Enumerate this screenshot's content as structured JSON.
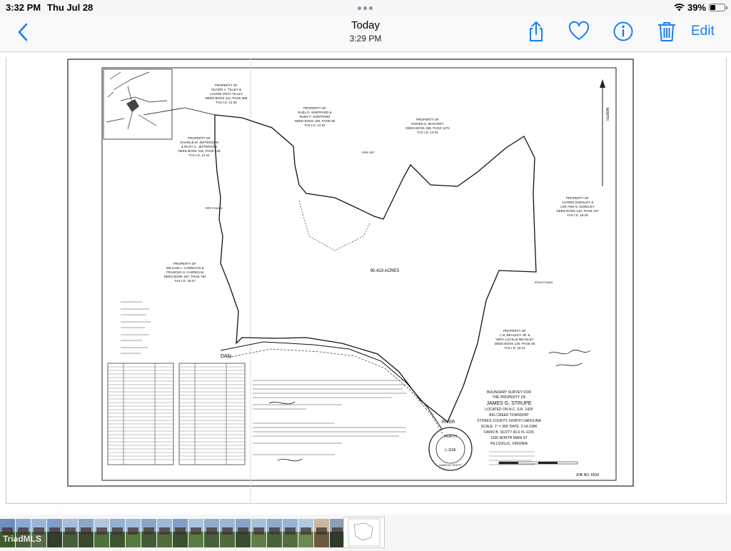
{
  "status": {
    "time": "3:32 PM",
    "date": "Thu Jul 28",
    "battery": "39%",
    "battery_level": 0.39
  },
  "nav": {
    "title": "Today",
    "subtitle": "3:29 PM",
    "edit_label": "Edit"
  },
  "colors": {
    "accent": "#157efb"
  },
  "icons": [
    "back-chevron-icon",
    "share-icon",
    "heart-icon",
    "info-icon",
    "trash-icon",
    "wifi-icon",
    "battery-icon"
  ],
  "plat": {
    "acres": "90.413 ACRES",
    "job_no": "JOB NO. 6539",
    "big_creek": "BIG CREEK TOWNSHIP",
    "stokes": "STOKES COUNTY, NORTH CAROLINA",
    "scale": "SCALE: 1\" = 300'  DATE: 2-14-1996",
    "surveyor": "DAVID B. SCOTT RLS #L-1156",
    "address": "1626 NORTH MAIN ST",
    "city": "HILLSVILLE, VIRGINIA",
    "boundary": "BOUNDARY SURVEY FOR",
    "property_of": "THE PROPERTY OF",
    "owner": "JAMES G. STRUPE",
    "located": "LOCATED ON N.C. S.R. 1425",
    "labels": {
      "tilley": [
        "PROPERTY OF",
        "OLIVER A. TILLEY &",
        "LOUISE GRAY TILLEY",
        "DEED BOOK 113, PAGE 388",
        "TAX I.D. 14-36"
      ],
      "sheppard": [
        "PROPERTY OF",
        "EUEL R. SHEPPARD &",
        "RUBY F. SHEPPARD",
        "DEED BOOK 190, PAGE 80",
        "TAX I.D. 14-32"
      ],
      "mcgarry": [
        "PROPERTY OF",
        "ROGER S. McGARRY",
        "DEED BOOK 258, PAGE 1473",
        "TAX I.D. 14-31"
      ],
      "jefferson": [
        "PROPERTY OF",
        "CHARLIE M. JEFFERSON",
        "& RUTH C. JEFFERSON",
        "DEED BOOK 215, PAGE 249",
        "TAX I.D. 14-41"
      ],
      "carrigan": [
        "PROPERTY OF",
        "WILLIAM L. CARRIGAN &",
        "FRANCES H. CARRIGAN",
        "DEED BOOK 337, PAGE 764",
        "TAX I.D. 15-27"
      ],
      "dunkley": [
        "PROPERTY OF",
        "ALFRED DUNKLEY &",
        "LEE ANN G. DUNKLEY",
        "DEED BOOK 132, PAGE 157",
        "TAX I.D. 18-28"
      ],
      "beasley": [
        "PROPERTY OF",
        "J. B. BEASLEY JR. &",
        "VERA LUCILLE BEASLEY",
        "DEED BOOK 130, PAGE 68",
        "TAX I.D. 19-11"
      ]
    },
    "small_labels": {
      "pipe_found": "PIPE FOUND",
      "pipe_set": "PIPE SET",
      "dan": "DAN",
      "river": "RIVER",
      "iron_found": "IRON FOUND",
      "north": "NORTH",
      "carolina": "CAROLINA",
      "seal": "L-1156",
      "sc": "DAVID B. SCOTT"
    }
  },
  "watermark": "TriadMLS"
}
